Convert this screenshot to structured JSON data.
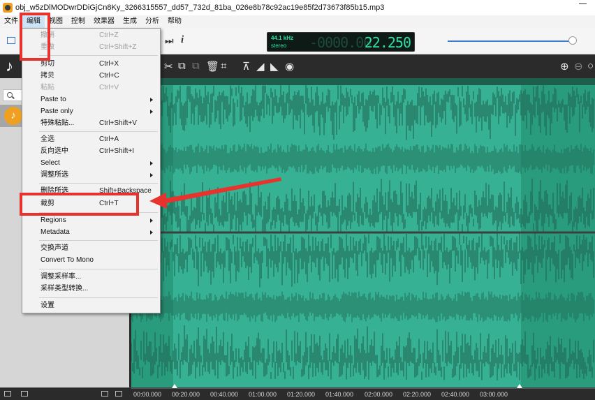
{
  "window": {
    "title": "obj_w5zDlMODwrDDiGjCn8Ky_3266315557_dd57_732d_81ba_026e8b78c92ac19e85f2d73673f85b15.mp3"
  },
  "menubar": [
    "文件",
    "编辑",
    "视图",
    "控制",
    "效果器",
    "生成",
    "分析",
    "帮助"
  ],
  "menubar_active": "编辑",
  "display": {
    "sample_rate": "44.1 kHz",
    "channels": "stereo",
    "time_dim": "-0000.00",
    "time": "22.250"
  },
  "volume": 0.96,
  "edit_menu": [
    {
      "label": "撤销",
      "shortcut": "Ctrl+Z",
      "disabled": true
    },
    {
      "label": "重做",
      "shortcut": "Ctrl+Shift+Z",
      "disabled": true
    },
    {
      "label": "剪切",
      "shortcut": "Ctrl+X"
    },
    {
      "label": "拷贝",
      "shortcut": "Ctrl+C"
    },
    {
      "label": "粘贴",
      "shortcut": "Ctrl+V",
      "disabled": true
    },
    {
      "label": "Paste to",
      "submenu": true
    },
    {
      "label": "Paste only",
      "submenu": true
    },
    {
      "label": "特殊粘贴...",
      "shortcut": "Ctrl+Shift+V"
    },
    {
      "label": "全选",
      "shortcut": "Ctrl+A"
    },
    {
      "label": "反向选中",
      "shortcut": "Ctrl+Shift+I"
    },
    {
      "label": "Select",
      "submenu": true
    },
    {
      "label": "调整所选",
      "submenu": true
    },
    {
      "label": "删除所选",
      "shortcut": "Shift+Backspace"
    },
    {
      "label": "裁剪",
      "shortcut": "Ctrl+T"
    },
    {
      "label": "Regions",
      "submenu": true
    },
    {
      "label": "Metadata",
      "submenu": true
    },
    {
      "label": "交换声道"
    },
    {
      "label": "Convert To Mono"
    },
    {
      "label": "调整采样率..."
    },
    {
      "label": "采样类型转换..."
    },
    {
      "label": "设置"
    }
  ],
  "timeline": [
    "00:00.000",
    "00:20.000",
    "00:40.000",
    "01:00.000",
    "01:20.000",
    "01:40.000",
    "02:00.000",
    "02:20.000",
    "02:40.000",
    "03:00.000"
  ],
  "colors": {
    "waveform": "#2a9c7e",
    "selection": "#3ab597",
    "annotation": "#e8322e",
    "lcd_text": "#2ee0a3"
  }
}
